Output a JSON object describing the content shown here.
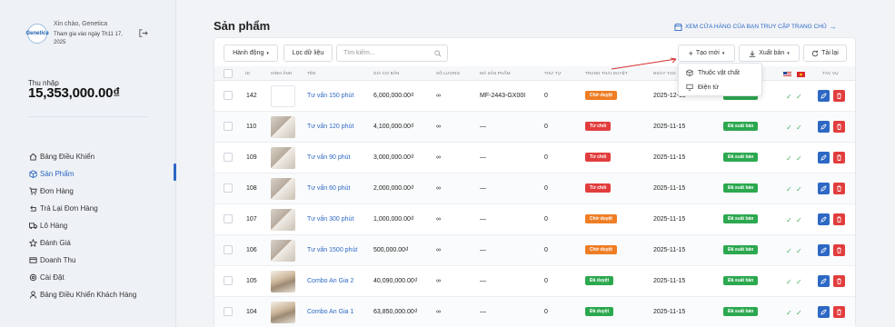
{
  "sidebar": {
    "logo_text": "Genetica",
    "greeting": "Xin chào, Genetica",
    "joined": "Tham gia vào ngày Th11 17, 2025",
    "income_label": "Thu nhập",
    "income_value": "15,353,000.00₫",
    "nav": [
      {
        "label": "Bảng Điều Khiển",
        "icon": "home-icon"
      },
      {
        "label": "Sản Phẩm",
        "icon": "box-icon",
        "active": true
      },
      {
        "label": "Đơn Hàng",
        "icon": "cart-icon"
      },
      {
        "label": "Trả Lại Đơn Hàng",
        "icon": "return-icon"
      },
      {
        "label": "Lô Hàng",
        "icon": "truck-icon"
      },
      {
        "label": "Đánh Giá",
        "icon": "star-icon"
      },
      {
        "label": "Doanh Thu",
        "icon": "revenue-icon"
      },
      {
        "label": "Cài Đặt",
        "icon": "gear-icon"
      },
      {
        "label": "Bảng Điều Khiển Khách Hàng",
        "icon": "user-icon"
      }
    ]
  },
  "header": {
    "title": "Sản phẩm",
    "store_link": "XEM CỬA HÀNG CỦA BẠN TRUY CẬP TRANG CHỦ"
  },
  "toolbar": {
    "actions_label": "Hành động",
    "filter_label": "Lọc dữ liệu",
    "search_placeholder": "Tìm kiếm...",
    "create_label": "Tạo mới",
    "export_label": "Xuất bản",
    "reload_label": "Tải lại"
  },
  "dropdown": {
    "items": [
      "Thuộc vật chất",
      "Điện tử"
    ]
  },
  "table": {
    "headers": {
      "id": "ID",
      "image": "HÌNH ẢNH",
      "name": "TÊN",
      "price": "GIÁ CƠ BẢN",
      "qty": "SỐ LƯỢNG",
      "sku": "MÃ SẢN PHẨM",
      "order": "THỨ TỰ",
      "approval": "TRẠNG THÁI DUYỆT",
      "date": "NGÀY TẠO",
      "actions": "TÁC VỤ"
    },
    "rows": [
      {
        "id": "142",
        "name": "Tư vấn 150 phút",
        "price": "6,000,000.00₫",
        "qty": "∞",
        "sku": "MF-2443-GX00I",
        "order": "0",
        "approval": "Chờ duyệt",
        "approval_color": "#ef7d24",
        "date": "2025-12-15",
        "status": "Đã xuất bản",
        "image": "blank"
      },
      {
        "id": "110",
        "name": "Tư vấn 120 phút",
        "price": "4,100,000.00₫",
        "qty": "∞",
        "sku": "—",
        "order": "0",
        "approval": "Từ chối",
        "approval_color": "#e23d3d",
        "date": "2025-11-15",
        "status": "Đã xuất bản",
        "image": "photo"
      },
      {
        "id": "109",
        "name": "Tư vấn 90 phút",
        "price": "3,000,000.00₫",
        "qty": "∞",
        "sku": "—",
        "order": "0",
        "approval": "Từ chối",
        "approval_color": "#e23d3d",
        "date": "2025-11-15",
        "status": "Đã xuất bản",
        "image": "photo"
      },
      {
        "id": "108",
        "name": "Tư vấn 60 phút",
        "price": "2,000,000.00₫",
        "qty": "∞",
        "sku": "—",
        "order": "0",
        "approval": "Từ chối",
        "approval_color": "#e23d3d",
        "date": "2025-11-15",
        "status": "Đã xuất bản",
        "image": "photo"
      },
      {
        "id": "107",
        "name": "Tư vấn 300 phút",
        "price": "1,000,000.00₫",
        "qty": "∞",
        "sku": "—",
        "order": "0",
        "approval": "Chờ duyệt",
        "approval_color": "#ef7d24",
        "date": "2025-11-15",
        "status": "Đã xuất bản",
        "image": "photo"
      },
      {
        "id": "106",
        "name": "Tư vấn 1500 phút",
        "price": "500,000.00₫",
        "qty": "∞",
        "sku": "—",
        "order": "0",
        "approval": "Chờ duyệt",
        "approval_color": "#ef7d24",
        "date": "2025-11-15",
        "status": "Đã xuất bản",
        "image": "photo"
      },
      {
        "id": "105",
        "name": "Combo An Gia 2",
        "price": "40,090,000.00₫",
        "qty": "∞",
        "sku": "—",
        "order": "0",
        "approval": "Đã duyệt",
        "approval_color": "#2ca84f",
        "date": "2025-11-15",
        "status": "Đã xuất bản",
        "image": "combo"
      },
      {
        "id": "104",
        "name": "Combo An Gia 1",
        "price": "63,850,000.00₫",
        "qty": "∞",
        "sku": "—",
        "order": "0",
        "approval": "Đã duyệt",
        "approval_color": "#2ca84f",
        "date": "2025-11-15",
        "status": "Đã xuất bản",
        "image": "combo"
      }
    ]
  },
  "colors": {
    "accent": "#2d68c4",
    "orange": "#ef7d24",
    "red": "#e23d3d",
    "green": "#2ca84f"
  }
}
